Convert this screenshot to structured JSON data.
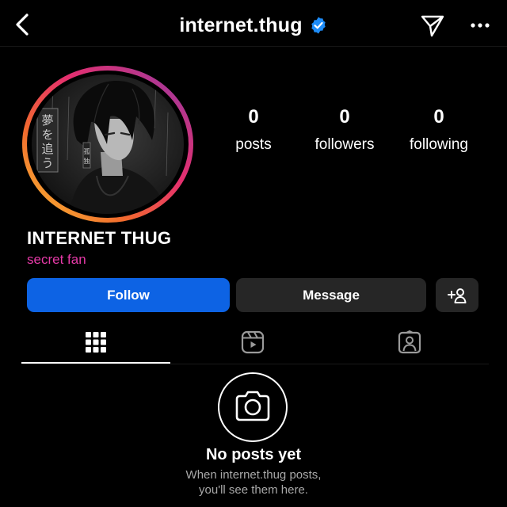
{
  "header": {
    "title": "internet.thug",
    "verified": true,
    "icons": [
      "back-chevron-icon",
      "verified-badge-icon",
      "send-paper-plane-icon",
      "more-dots-icon"
    ]
  },
  "profile": {
    "display_name": "INTERNET THUG",
    "bio": "secret fan",
    "avatar": "anime-portrait-in-gradient-story-ring",
    "stats": {
      "posts": {
        "value": "0",
        "label": "posts"
      },
      "followers": {
        "value": "0",
        "label": "followers"
      },
      "following": {
        "value": "0",
        "label": "following"
      }
    }
  },
  "actions": {
    "follow_label": "Follow",
    "message_label": "Message",
    "add_user_icon": "add-person-icon"
  },
  "tabs": [
    {
      "name": "posts-grid",
      "icon": "grid-icon",
      "active": true
    },
    {
      "name": "reels",
      "icon": "reels-icon",
      "active": false
    },
    {
      "name": "tagged",
      "icon": "tagged-person-icon",
      "active": false
    }
  ],
  "empty_state": {
    "icon": "camera-icon",
    "title": "No posts yet",
    "subtitle_line1": "When internet.thug posts,",
    "subtitle_line2": "you'll see them here."
  },
  "colors": {
    "background": "#000000",
    "follow_button": "#0d63e4",
    "secondary_button": "#262626",
    "bio_text": "#e63aa8",
    "verified_badge": "#1d8cf8",
    "ring_gradient": [
      "#f9c033",
      "#f26a2e",
      "#e52f6f",
      "#c13584",
      "#833ab4"
    ]
  }
}
